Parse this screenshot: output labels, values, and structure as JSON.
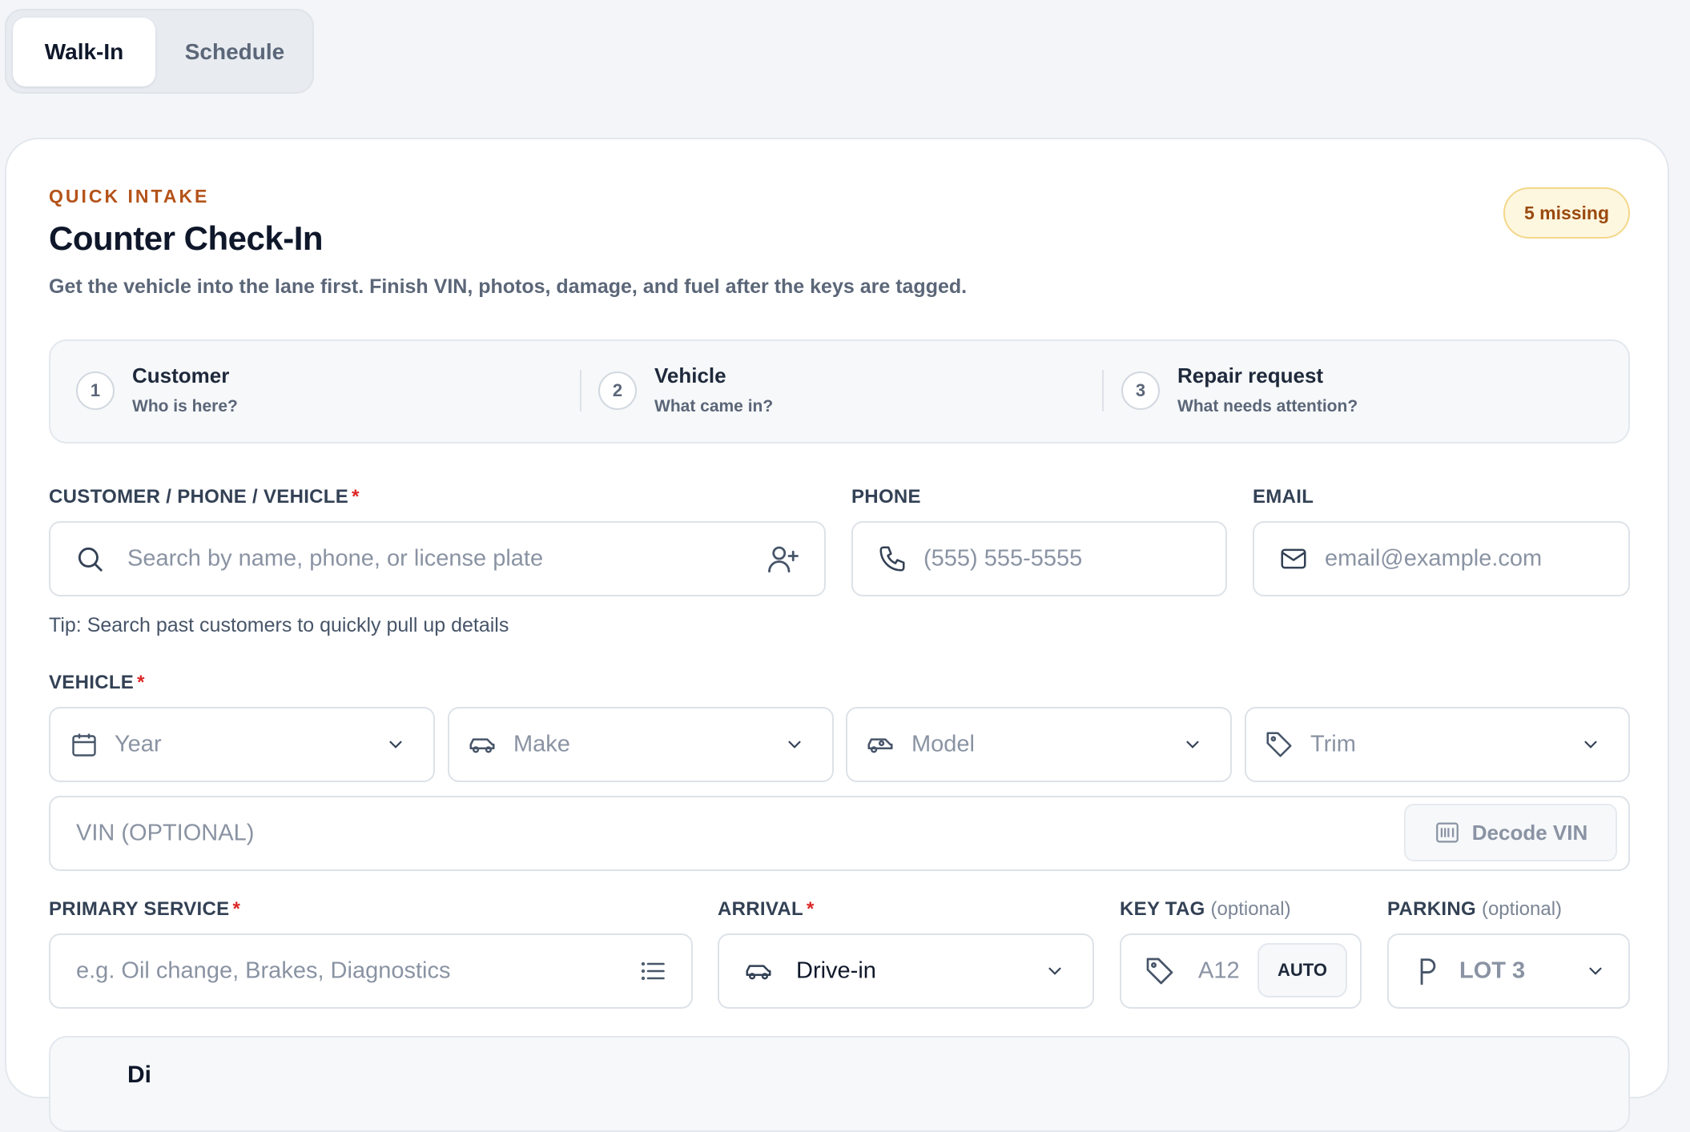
{
  "mode_tabs": [
    {
      "label": "Walk-In",
      "active": true
    },
    {
      "label": "Schedule",
      "active": false
    }
  ],
  "header": {
    "eyebrow": "QUICK INTAKE",
    "title": "Counter Check-In",
    "subtitle": "Get the vehicle into the lane first. Finish VIN, photos, damage, and fuel after the keys are tagged.",
    "missing_badge": "5 missing"
  },
  "steps": [
    {
      "number": "1",
      "title": "Customer",
      "subtitle": "Who is here?"
    },
    {
      "number": "2",
      "title": "Vehicle",
      "subtitle": "What came in?"
    },
    {
      "number": "3",
      "title": "Repair request",
      "subtitle": "What needs attention?"
    }
  ],
  "customer": {
    "label": "CUSTOMER / PHONE / VEHICLE",
    "required_mark": "*",
    "placeholder": "Search by name, phone, or license plate",
    "tip": "Tip: Search past customers to quickly pull up details"
  },
  "phone": {
    "label": "PHONE",
    "placeholder": "(555) 555-5555"
  },
  "email": {
    "label": "EMAIL",
    "placeholder": "email@example.com"
  },
  "vehicle": {
    "label": "VEHICLE",
    "required_mark": "*",
    "year_placeholder": "Year",
    "make_placeholder": "Make",
    "model_placeholder": "Model",
    "trim_placeholder": "Trim",
    "vin_placeholder": "VIN (OPTIONAL)",
    "decode_label": "Decode VIN"
  },
  "service": {
    "label": "PRIMARY SERVICE",
    "required_mark": "*",
    "placeholder": "e.g. Oil change, Brakes, Diagnostics"
  },
  "arrival": {
    "label": "ARRIVAL",
    "required_mark": "*",
    "value": "Drive-in"
  },
  "key_tag": {
    "label": "KEY TAG",
    "optional": "(optional)",
    "value": "A12",
    "auto_label": "AUTO"
  },
  "parking": {
    "label": "PARKING",
    "optional": "(optional)",
    "value": "LOT 3"
  },
  "next_section": {
    "title": "Di"
  },
  "colors": {
    "accent_eyebrow": "#b4531a",
    "required": "#dc2626",
    "badge_bg": "#fef7e0",
    "badge_text": "#9a4a0f",
    "page_bg": "#f3f5f8"
  }
}
